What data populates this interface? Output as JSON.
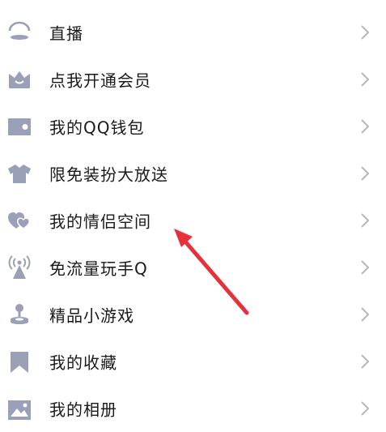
{
  "menu": {
    "items": [
      {
        "label": "直播",
        "icon": "live-icon"
      },
      {
        "label": "点我开通会员",
        "icon": "crown-icon"
      },
      {
        "label": "我的QQ钱包",
        "icon": "wallet-icon"
      },
      {
        "label": "限免装扮大放送",
        "icon": "tshirt-icon"
      },
      {
        "label": "我的情侣空间",
        "icon": "couple-hearts-icon"
      },
      {
        "label": "免流量玩手Q",
        "icon": "antenna-icon"
      },
      {
        "label": "精品小游戏",
        "icon": "joystick-icon"
      },
      {
        "label": "我的收藏",
        "icon": "bookmark-icon"
      },
      {
        "label": "我的相册",
        "icon": "photo-icon"
      }
    ]
  },
  "colors": {
    "icon": "#9aa0b8",
    "chevron": "#b8b8b8",
    "text": "#1a1a1a",
    "annotation_arrow": "#e8303a"
  }
}
